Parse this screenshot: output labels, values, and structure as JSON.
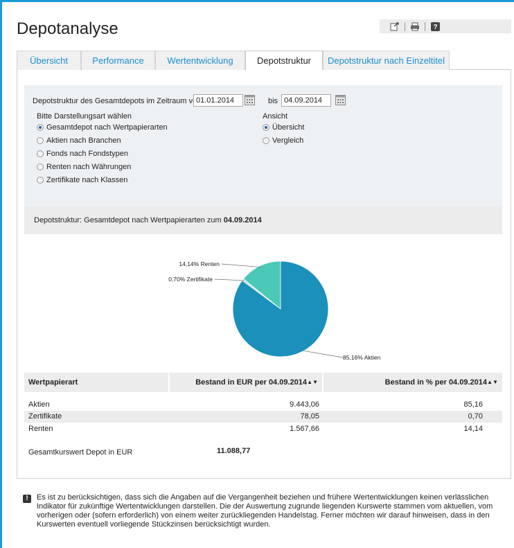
{
  "page": {
    "title": "Depotanalyse"
  },
  "toolbar": {
    "export_icon": "export-icon",
    "print_icon": "print-icon",
    "help_icon": "help-icon"
  },
  "tabs": [
    {
      "label": "Übersicht",
      "active": false
    },
    {
      "label": "Performance",
      "active": false
    },
    {
      "label": "Wertentwicklung",
      "active": false
    },
    {
      "label": "Depotstruktur",
      "active": true
    },
    {
      "label": "Depotstruktur nach Einzeltitel",
      "active": false
    }
  ],
  "filter": {
    "range_label": "Depotstruktur des Gesamtdepots im Zeitraum von",
    "from_date": "01.01.2014",
    "to_label": "bis",
    "to_date": "04.09.2014",
    "type_heading": "Bitte Darstellungsart wählen",
    "type_options": [
      {
        "label": "Gesamtdepot nach Wertpapierarten",
        "selected": true
      },
      {
        "label": "Aktien nach Branchen",
        "selected": false
      },
      {
        "label": "Fonds nach Fondstypen",
        "selected": false
      },
      {
        "label": "Renten nach Währungen",
        "selected": false
      },
      {
        "label": "Zertifikate nach Klassen",
        "selected": false
      }
    ],
    "view_heading": "Ansicht",
    "view_options": [
      {
        "label": "Übersicht",
        "selected": true
      },
      {
        "label": "Vergleich",
        "selected": false
      }
    ]
  },
  "summary": {
    "prefix": "Depotstruktur: Gesamtdepot nach Wertpapierarten zum ",
    "date": "04.09.2014"
  },
  "chart_data": {
    "type": "pie",
    "slices": [
      {
        "label": "85,16% Aktien",
        "value": 85.16,
        "color": "#1a90bb"
      },
      {
        "label": "0,70% Zertifikate",
        "value": 0.7,
        "color": "#b9dde0"
      },
      {
        "label": "14,14% Renten",
        "value": 14.14,
        "color": "#4cc8b6"
      }
    ]
  },
  "table": {
    "headers": [
      "Wertpapierart",
      "Bestand in EUR per 04.09.2014",
      "Bestand in % per 04.09.2014"
    ],
    "sort_icon": "sort-arrows-icon",
    "rows": [
      {
        "name": "Aktien",
        "eur": "9.443,06",
        "pct": "85,16"
      },
      {
        "name": "Zertifikate",
        "eur": "78,05",
        "pct": "0,70"
      },
      {
        "name": "Renten",
        "eur": "1.567,66",
        "pct": "14,14"
      }
    ],
    "total_label": "Gesamtkurswert Depot in EUR",
    "total_value": "11.088,77"
  },
  "note": {
    "icon": "warning-icon",
    "text": "Es ist zu berücksichtigen, dass sich die Angaben auf die Vergangenheit beziehen und frühere Wertentwicklungen keinen verlässlichen Indikator für zukünftige Wertentwicklungen darstellen. Die der Auswertung zugrunde liegenden Kurswerte stammen vom aktuellen, vom vorherigen oder (sofern erforderlich) von einem weiter zurückliegenden Handelstag. Ferner möchten wir darauf hinweisen, dass in den Kurswerten eventuell vorliegende Stückzinsen berücksichtigt wurden."
  }
}
